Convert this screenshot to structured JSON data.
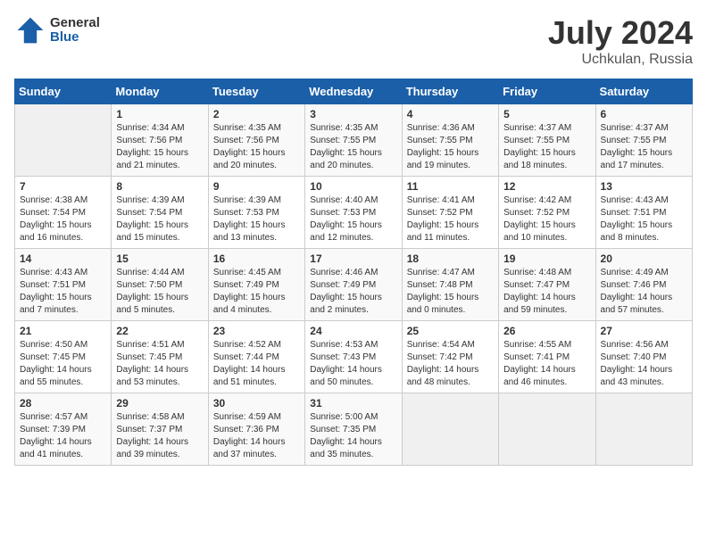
{
  "logo": {
    "general": "General",
    "blue": "Blue"
  },
  "title": "July 2024",
  "subtitle": "Uchkulan, Russia",
  "days_of_week": [
    "Sunday",
    "Monday",
    "Tuesday",
    "Wednesday",
    "Thursday",
    "Friday",
    "Saturday"
  ],
  "weeks": [
    [
      {
        "day": "",
        "info": ""
      },
      {
        "day": "1",
        "info": "Sunrise: 4:34 AM\nSunset: 7:56 PM\nDaylight: 15 hours\nand 21 minutes."
      },
      {
        "day": "2",
        "info": "Sunrise: 4:35 AM\nSunset: 7:56 PM\nDaylight: 15 hours\nand 20 minutes."
      },
      {
        "day": "3",
        "info": "Sunrise: 4:35 AM\nSunset: 7:55 PM\nDaylight: 15 hours\nand 20 minutes."
      },
      {
        "day": "4",
        "info": "Sunrise: 4:36 AM\nSunset: 7:55 PM\nDaylight: 15 hours\nand 19 minutes."
      },
      {
        "day": "5",
        "info": "Sunrise: 4:37 AM\nSunset: 7:55 PM\nDaylight: 15 hours\nand 18 minutes."
      },
      {
        "day": "6",
        "info": "Sunrise: 4:37 AM\nSunset: 7:55 PM\nDaylight: 15 hours\nand 17 minutes."
      }
    ],
    [
      {
        "day": "7",
        "info": "Sunrise: 4:38 AM\nSunset: 7:54 PM\nDaylight: 15 hours\nand 16 minutes."
      },
      {
        "day": "8",
        "info": "Sunrise: 4:39 AM\nSunset: 7:54 PM\nDaylight: 15 hours\nand 15 minutes."
      },
      {
        "day": "9",
        "info": "Sunrise: 4:39 AM\nSunset: 7:53 PM\nDaylight: 15 hours\nand 13 minutes."
      },
      {
        "day": "10",
        "info": "Sunrise: 4:40 AM\nSunset: 7:53 PM\nDaylight: 15 hours\nand 12 minutes."
      },
      {
        "day": "11",
        "info": "Sunrise: 4:41 AM\nSunset: 7:52 PM\nDaylight: 15 hours\nand 11 minutes."
      },
      {
        "day": "12",
        "info": "Sunrise: 4:42 AM\nSunset: 7:52 PM\nDaylight: 15 hours\nand 10 minutes."
      },
      {
        "day": "13",
        "info": "Sunrise: 4:43 AM\nSunset: 7:51 PM\nDaylight: 15 hours\nand 8 minutes."
      }
    ],
    [
      {
        "day": "14",
        "info": "Sunrise: 4:43 AM\nSunset: 7:51 PM\nDaylight: 15 hours\nand 7 minutes."
      },
      {
        "day": "15",
        "info": "Sunrise: 4:44 AM\nSunset: 7:50 PM\nDaylight: 15 hours\nand 5 minutes."
      },
      {
        "day": "16",
        "info": "Sunrise: 4:45 AM\nSunset: 7:49 PM\nDaylight: 15 hours\nand 4 minutes."
      },
      {
        "day": "17",
        "info": "Sunrise: 4:46 AM\nSunset: 7:49 PM\nDaylight: 15 hours\nand 2 minutes."
      },
      {
        "day": "18",
        "info": "Sunrise: 4:47 AM\nSunset: 7:48 PM\nDaylight: 15 hours\nand 0 minutes."
      },
      {
        "day": "19",
        "info": "Sunrise: 4:48 AM\nSunset: 7:47 PM\nDaylight: 14 hours\nand 59 minutes."
      },
      {
        "day": "20",
        "info": "Sunrise: 4:49 AM\nSunset: 7:46 PM\nDaylight: 14 hours\nand 57 minutes."
      }
    ],
    [
      {
        "day": "21",
        "info": "Sunrise: 4:50 AM\nSunset: 7:45 PM\nDaylight: 14 hours\nand 55 minutes."
      },
      {
        "day": "22",
        "info": "Sunrise: 4:51 AM\nSunset: 7:45 PM\nDaylight: 14 hours\nand 53 minutes."
      },
      {
        "day": "23",
        "info": "Sunrise: 4:52 AM\nSunset: 7:44 PM\nDaylight: 14 hours\nand 51 minutes."
      },
      {
        "day": "24",
        "info": "Sunrise: 4:53 AM\nSunset: 7:43 PM\nDaylight: 14 hours\nand 50 minutes."
      },
      {
        "day": "25",
        "info": "Sunrise: 4:54 AM\nSunset: 7:42 PM\nDaylight: 14 hours\nand 48 minutes."
      },
      {
        "day": "26",
        "info": "Sunrise: 4:55 AM\nSunset: 7:41 PM\nDaylight: 14 hours\nand 46 minutes."
      },
      {
        "day": "27",
        "info": "Sunrise: 4:56 AM\nSunset: 7:40 PM\nDaylight: 14 hours\nand 43 minutes."
      }
    ],
    [
      {
        "day": "28",
        "info": "Sunrise: 4:57 AM\nSunset: 7:39 PM\nDaylight: 14 hours\nand 41 minutes."
      },
      {
        "day": "29",
        "info": "Sunrise: 4:58 AM\nSunset: 7:37 PM\nDaylight: 14 hours\nand 39 minutes."
      },
      {
        "day": "30",
        "info": "Sunrise: 4:59 AM\nSunset: 7:36 PM\nDaylight: 14 hours\nand 37 minutes."
      },
      {
        "day": "31",
        "info": "Sunrise: 5:00 AM\nSunset: 7:35 PM\nDaylight: 14 hours\nand 35 minutes."
      },
      {
        "day": "",
        "info": ""
      },
      {
        "day": "",
        "info": ""
      },
      {
        "day": "",
        "info": ""
      }
    ]
  ]
}
